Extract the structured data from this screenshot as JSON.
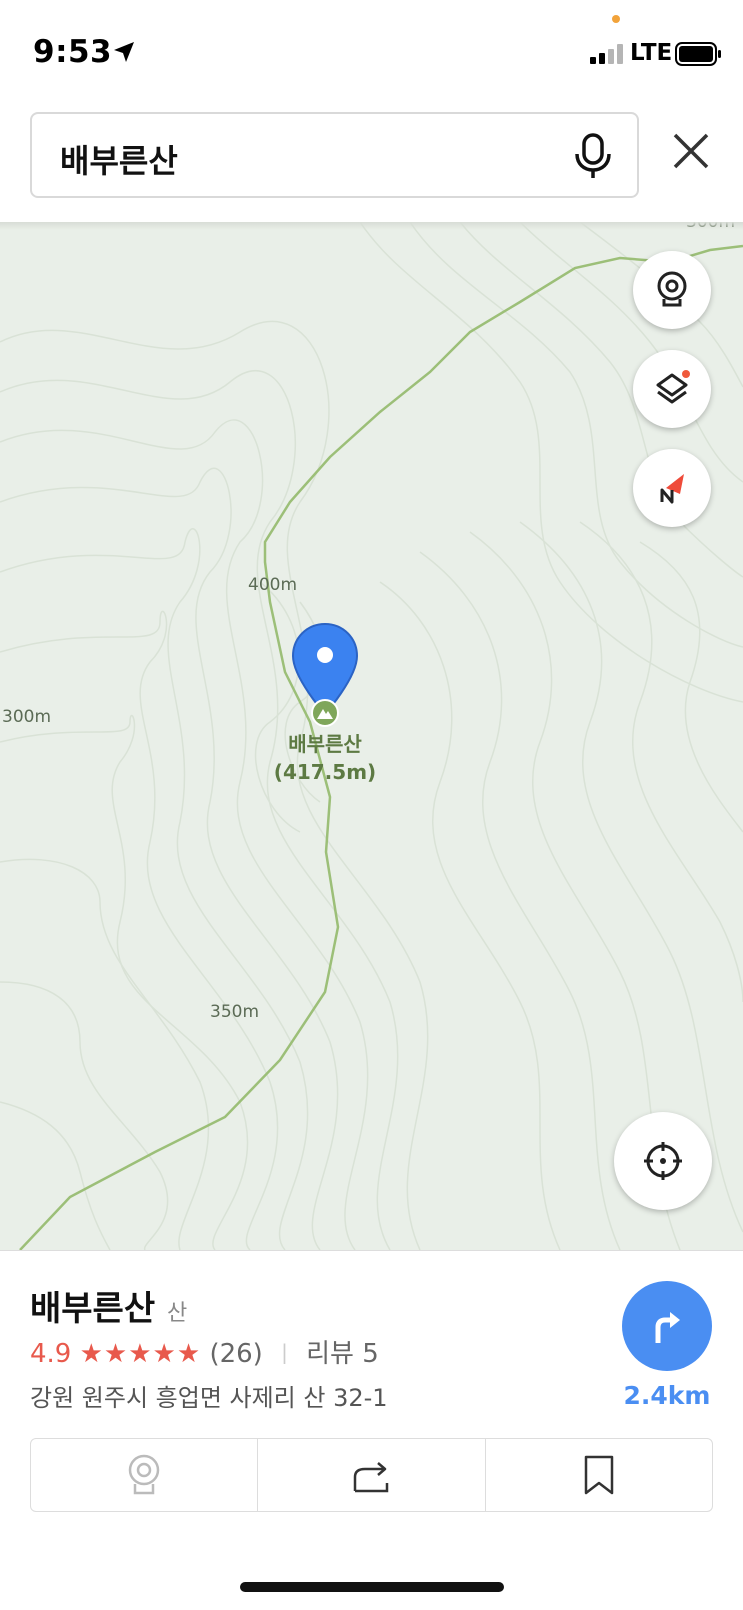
{
  "status_bar": {
    "time": "9:53",
    "network": "LTE"
  },
  "search": {
    "query": "배부른산"
  },
  "map": {
    "elevation_labels": [
      "300m",
      "400m",
      "300m",
      "350m"
    ],
    "peak": {
      "name": "배부른산",
      "height": "(417.5m)"
    }
  },
  "place": {
    "name": "배부른산",
    "category": "산",
    "rating": "4.9",
    "stars": "★★★★★",
    "review_count": "(26)",
    "review_label": "리뷰 5",
    "address": "강원 원주시 흥업면 사제리 산 32-1",
    "distance": "2.4km"
  },
  "colors": {
    "accent": "#4a8ef2",
    "rating": "#e8594c",
    "map_bg": "#e9efe8",
    "trail": "#9cbf78"
  },
  "icons": [
    "location-arrow-icon",
    "signal-icon",
    "battery-icon",
    "mic-icon",
    "close-icon",
    "street-view-icon",
    "layers-icon",
    "compass-icon",
    "current-location-icon",
    "map-pin-icon",
    "mountain-icon",
    "directions-arrow-icon",
    "share-icon",
    "bookmark-icon"
  ]
}
